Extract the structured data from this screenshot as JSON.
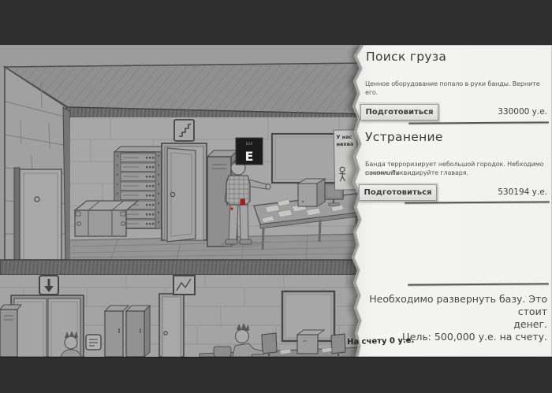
{
  "scene": {
    "key_prompt": {
      "key": "E",
      "hint": "ВЗЛ"
    },
    "poster": {
      "line1": "У нас",
      "line2": "нехва"
    },
    "icons": {
      "elevator_sign": "down-arrow-icon",
      "stairs_sign": "stairs-icon",
      "chart_frame": "zigzag-graph-icon"
    }
  },
  "panel": {
    "missions": [
      {
        "title": "Поиск груза",
        "description_lines": [
          "Ценное оборудование попало в руки банды. Верните его."
        ],
        "button_label": "Подготовиться",
        "reward": "330000 у.е."
      },
      {
        "title": "Устранение",
        "description_lines": [
          "Банда терроризирует небольшой городок. Небходимо покончить",
          "с ними. Ликвидируйте главаря."
        ],
        "button_label": "Подготовиться",
        "reward": "530194 у.е."
      }
    ],
    "goal_lines": [
      "Необходимо развернуть базу. Это стоит",
      "денег.",
      "Цель: 500,000 у.е. на счету."
    ],
    "balance": "На счету 0 у.е."
  },
  "colors": {
    "paper": "#f2f2f0",
    "letterbox": "#2f2f2f",
    "scene_background": "#9c9c9c",
    "prompt_background": "#1b1b1b",
    "accent_red": "#b5161a"
  }
}
